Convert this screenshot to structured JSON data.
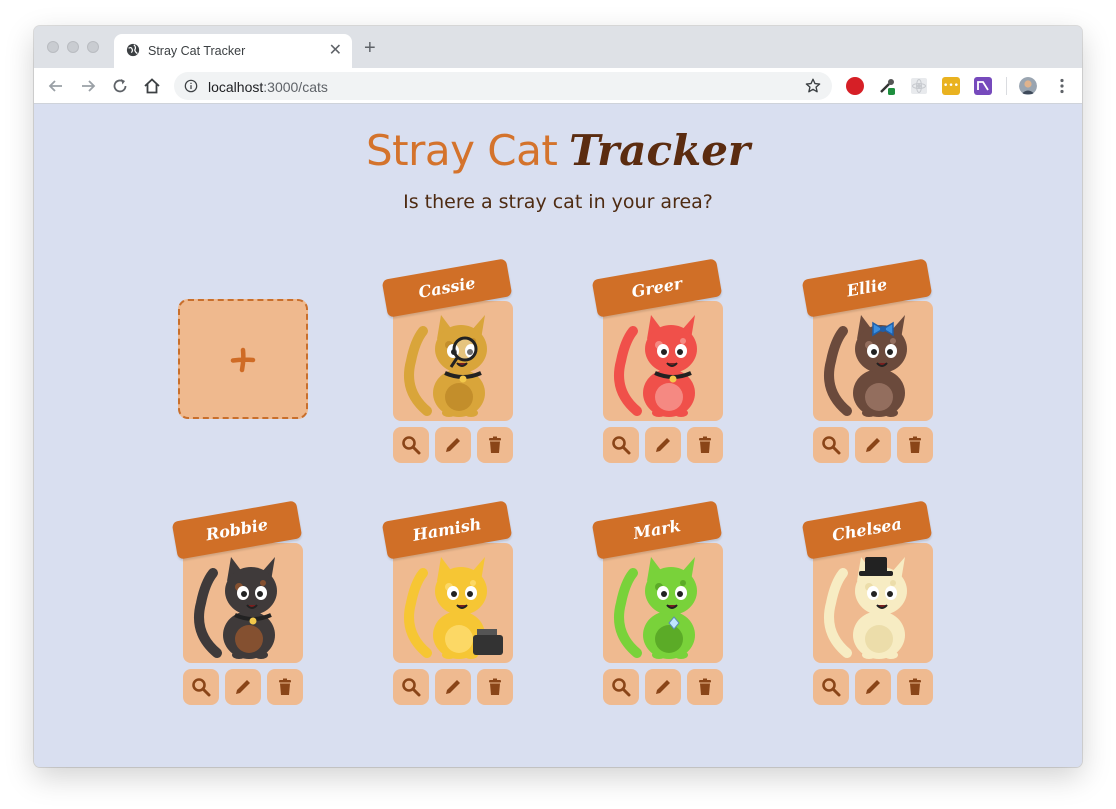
{
  "browser": {
    "tab_title": "Stray Cat Tracker",
    "url_host": "localhost",
    "url_path": ":3000/cats"
  },
  "page": {
    "title_part1": "Stray Cat",
    "title_part2": "Tracker",
    "subtitle": "Is there a stray cat in your area?"
  },
  "cats": [
    {
      "name": "Cassie",
      "color": "#d9a53a",
      "accent": "#b98425",
      "accessory": "magnifier-icon"
    },
    {
      "name": "Greer",
      "color": "#f0504a",
      "accent": "#f6a19a",
      "accessory": "collar-icon"
    },
    {
      "name": "Ellie",
      "color": "#6b4a3c",
      "accent": "#a47e6c",
      "accessory": "bow-icon"
    },
    {
      "name": "Robbie",
      "color": "#3f3a3a",
      "accent": "#a25a2c",
      "accessory": "collar-icon"
    },
    {
      "name": "Hamish",
      "color": "#f6c634",
      "accent": "#ffe07a",
      "accessory": "typewriter-icon"
    },
    {
      "name": "Mark",
      "color": "#79d23a",
      "accent": "#4f9a20",
      "accessory": "gem-icon"
    },
    {
      "name": "Chelsea",
      "color": "#f7ecc3",
      "accent": "#e7d7a0",
      "accessory": "top-hat-icon"
    }
  ],
  "colors": {
    "page_bg": "#d9dff0",
    "card_bg": "#efba90",
    "tag": "#d06f27",
    "action_icon": "#8a4518"
  }
}
